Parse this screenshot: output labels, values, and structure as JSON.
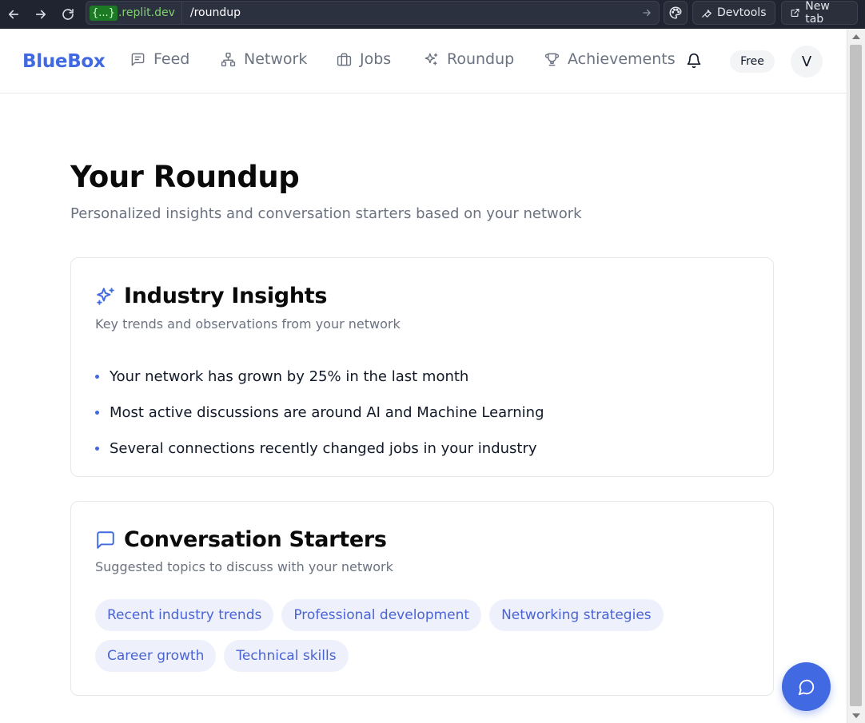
{
  "browser": {
    "url_host_braces": "{...}",
    "url_host_domain": ".replit.dev",
    "url_path": "/roundup",
    "devtools_label": "Devtools",
    "newtab_label": "New tab"
  },
  "nav": {
    "brand": "BlueBox",
    "items": [
      {
        "label": "Feed",
        "icon": "message-square-icon"
      },
      {
        "label": "Network",
        "icon": "network-icon"
      },
      {
        "label": "Jobs",
        "icon": "briefcase-icon"
      },
      {
        "label": "Roundup",
        "icon": "sparkles-icon"
      },
      {
        "label": "Achievements",
        "icon": "trophy-icon"
      }
    ],
    "plan_badge": "Free",
    "avatar_initial": "V"
  },
  "page": {
    "title": "Your Roundup",
    "subtitle": "Personalized insights and conversation starters based on your network"
  },
  "insights": {
    "title": "Industry Insights",
    "description": "Key trends and observations from your network",
    "items": [
      "Your network has grown by 25% in the last month",
      "Most active discussions are around AI and Machine Learning",
      "Several connections recently changed jobs in your industry"
    ]
  },
  "starters": {
    "title": "Conversation Starters",
    "description": "Suggested topics to discuss with your network",
    "topics": [
      "Recent industry trends",
      "Professional development",
      "Networking strategies",
      "Career growth",
      "Technical skills"
    ]
  },
  "colors": {
    "accent": "#4169e1",
    "muted_text": "#6b7280",
    "chip_bg": "#eef1fb"
  }
}
